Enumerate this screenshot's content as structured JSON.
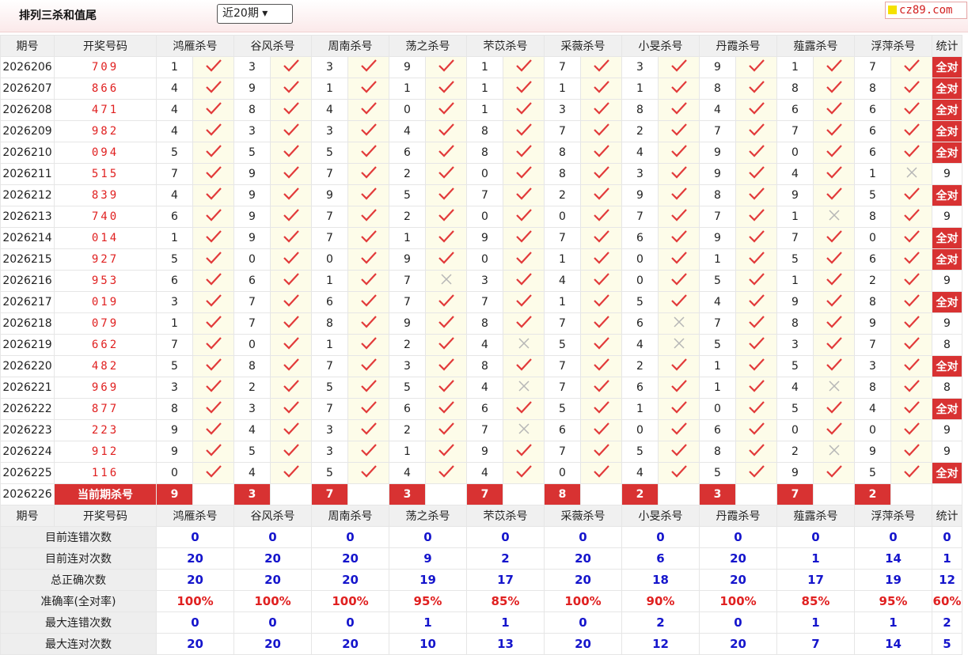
{
  "title": "排列三杀和值尾",
  "period_select": {
    "selected": "近20期 ▾"
  },
  "logo": {
    "text": "cz89.com"
  },
  "headers": {
    "issue": "期号",
    "draw": "开奖号码",
    "experts": [
      "鸿雁杀号",
      "谷风杀号",
      "周南杀号",
      "荡之杀号",
      "芣苡杀号",
      "采薇杀号",
      "小旻杀号",
      "丹霞杀号",
      "薤露杀号",
      "浮萍杀号"
    ],
    "stat": "统计"
  },
  "rows": [
    {
      "issue": "2026206",
      "draw": "709",
      "picks": [
        1,
        3,
        3,
        9,
        1,
        7,
        3,
        9,
        1,
        7
      ],
      "ok": [
        1,
        1,
        1,
        1,
        1,
        1,
        1,
        1,
        1,
        1
      ],
      "stat": "全对"
    },
    {
      "issue": "2026207",
      "draw": "866",
      "picks": [
        4,
        9,
        1,
        1,
        1,
        1,
        1,
        8,
        8,
        8
      ],
      "ok": [
        1,
        1,
        1,
        1,
        1,
        1,
        1,
        1,
        1,
        1
      ],
      "stat": "全对"
    },
    {
      "issue": "2026208",
      "draw": "471",
      "picks": [
        4,
        8,
        4,
        0,
        1,
        3,
        8,
        4,
        6,
        6
      ],
      "ok": [
        1,
        1,
        1,
        1,
        1,
        1,
        1,
        1,
        1,
        1
      ],
      "stat": "全对"
    },
    {
      "issue": "2026209",
      "draw": "982",
      "picks": [
        4,
        3,
        3,
        4,
        8,
        7,
        2,
        7,
        7,
        6
      ],
      "ok": [
        1,
        1,
        1,
        1,
        1,
        1,
        1,
        1,
        1,
        1
      ],
      "stat": "全对"
    },
    {
      "issue": "2026210",
      "draw": "094",
      "picks": [
        5,
        5,
        5,
        6,
        8,
        8,
        4,
        9,
        0,
        6
      ],
      "ok": [
        1,
        1,
        1,
        1,
        1,
        1,
        1,
        1,
        1,
        1
      ],
      "stat": "全对"
    },
    {
      "issue": "2026211",
      "draw": "515",
      "picks": [
        7,
        9,
        7,
        2,
        0,
        8,
        3,
        9,
        4,
        1
      ],
      "ok": [
        1,
        1,
        1,
        1,
        1,
        1,
        1,
        1,
        1,
        0
      ],
      "stat": "9"
    },
    {
      "issue": "2026212",
      "draw": "839",
      "picks": [
        4,
        9,
        9,
        5,
        7,
        2,
        9,
        8,
        9,
        5
      ],
      "ok": [
        1,
        1,
        1,
        1,
        1,
        1,
        1,
        1,
        1,
        1
      ],
      "stat": "全对"
    },
    {
      "issue": "2026213",
      "draw": "740",
      "picks": [
        6,
        9,
        7,
        2,
        0,
        0,
        7,
        7,
        1,
        8
      ],
      "ok": [
        1,
        1,
        1,
        1,
        1,
        1,
        1,
        1,
        0,
        1
      ],
      "stat": "9"
    },
    {
      "issue": "2026214",
      "draw": "014",
      "picks": [
        1,
        9,
        7,
        1,
        9,
        7,
        6,
        9,
        7,
        0
      ],
      "ok": [
        1,
        1,
        1,
        1,
        1,
        1,
        1,
        1,
        1,
        1
      ],
      "stat": "全对"
    },
    {
      "issue": "2026215",
      "draw": "927",
      "picks": [
        5,
        0,
        0,
        9,
        0,
        1,
        0,
        1,
        5,
        6
      ],
      "ok": [
        1,
        1,
        1,
        1,
        1,
        1,
        1,
        1,
        1,
        1
      ],
      "stat": "全对"
    },
    {
      "issue": "2026216",
      "draw": "953",
      "picks": [
        6,
        6,
        1,
        7,
        3,
        4,
        0,
        5,
        1,
        2
      ],
      "ok": [
        1,
        1,
        1,
        0,
        1,
        1,
        1,
        1,
        1,
        1
      ],
      "stat": "9"
    },
    {
      "issue": "2026217",
      "draw": "019",
      "picks": [
        3,
        7,
        6,
        7,
        7,
        1,
        5,
        4,
        9,
        8
      ],
      "ok": [
        1,
        1,
        1,
        1,
        1,
        1,
        1,
        1,
        1,
        1
      ],
      "stat": "全对"
    },
    {
      "issue": "2026218",
      "draw": "079",
      "picks": [
        1,
        7,
        8,
        9,
        8,
        7,
        6,
        7,
        8,
        9
      ],
      "ok": [
        1,
        1,
        1,
        1,
        1,
        1,
        0,
        1,
        1,
        1
      ],
      "stat": "9"
    },
    {
      "issue": "2026219",
      "draw": "662",
      "picks": [
        7,
        0,
        1,
        2,
        4,
        5,
        4,
        5,
        3,
        7
      ],
      "ok": [
        1,
        1,
        1,
        1,
        0,
        1,
        0,
        1,
        1,
        1
      ],
      "stat": "8"
    },
    {
      "issue": "2026220",
      "draw": "482",
      "picks": [
        5,
        8,
        7,
        3,
        8,
        7,
        2,
        1,
        5,
        3
      ],
      "ok": [
        1,
        1,
        1,
        1,
        1,
        1,
        1,
        1,
        1,
        1
      ],
      "stat": "全对"
    },
    {
      "issue": "2026221",
      "draw": "969",
      "picks": [
        3,
        2,
        5,
        5,
        4,
        7,
        6,
        1,
        4,
        8
      ],
      "ok": [
        1,
        1,
        1,
        1,
        0,
        1,
        1,
        1,
        0,
        1
      ],
      "stat": "8"
    },
    {
      "issue": "2026222",
      "draw": "877",
      "picks": [
        8,
        3,
        7,
        6,
        6,
        5,
        1,
        0,
        5,
        4
      ],
      "ok": [
        1,
        1,
        1,
        1,
        1,
        1,
        1,
        1,
        1,
        1
      ],
      "stat": "全对"
    },
    {
      "issue": "2026223",
      "draw": "223",
      "picks": [
        9,
        4,
        3,
        2,
        7,
        6,
        0,
        6,
        0,
        0
      ],
      "ok": [
        1,
        1,
        1,
        1,
        0,
        1,
        1,
        1,
        1,
        1
      ],
      "stat": "9"
    },
    {
      "issue": "2026224",
      "draw": "912",
      "picks": [
        9,
        5,
        3,
        1,
        9,
        7,
        5,
        8,
        2,
        9
      ],
      "ok": [
        1,
        1,
        1,
        1,
        1,
        1,
        1,
        1,
        0,
        1
      ],
      "stat": "9"
    },
    {
      "issue": "2026225",
      "draw": "116",
      "picks": [
        0,
        4,
        5,
        4,
        4,
        0,
        4,
        5,
        9,
        5
      ],
      "ok": [
        1,
        1,
        1,
        1,
        1,
        1,
        1,
        1,
        1,
        1
      ],
      "stat": "全对"
    }
  ],
  "current": {
    "issue": "2026226",
    "label": "当前期杀号",
    "picks": [
      9,
      3,
      7,
      3,
      7,
      8,
      2,
      3,
      7,
      2
    ]
  },
  "stats": [
    {
      "label": "目前连错次数",
      "values": [
        "0",
        "0",
        "0",
        "0",
        "0",
        "0",
        "0",
        "0",
        "0",
        "0",
        "0"
      ],
      "kind": "num"
    },
    {
      "label": "目前连对次数",
      "values": [
        "20",
        "20",
        "20",
        "9",
        "2",
        "20",
        "6",
        "20",
        "1",
        "14",
        "1"
      ],
      "kind": "num"
    },
    {
      "label": "总正确次数",
      "values": [
        "20",
        "20",
        "20",
        "19",
        "17",
        "20",
        "18",
        "20",
        "17",
        "19",
        "12"
      ],
      "kind": "num"
    },
    {
      "label": "准确率(全对率)",
      "values": [
        "100%",
        "100%",
        "100%",
        "95%",
        "85%",
        "100%",
        "90%",
        "100%",
        "85%",
        "95%",
        "60%"
      ],
      "kind": "rate"
    },
    {
      "label": "最大连错次数",
      "values": [
        "0",
        "0",
        "0",
        "1",
        "1",
        "0",
        "2",
        "0",
        "1",
        "1",
        "2"
      ],
      "kind": "num"
    },
    {
      "label": "最大连对次数",
      "values": [
        "20",
        "20",
        "20",
        "10",
        "13",
        "20",
        "12",
        "20",
        "7",
        "14",
        "5"
      ],
      "kind": "num"
    }
  ]
}
